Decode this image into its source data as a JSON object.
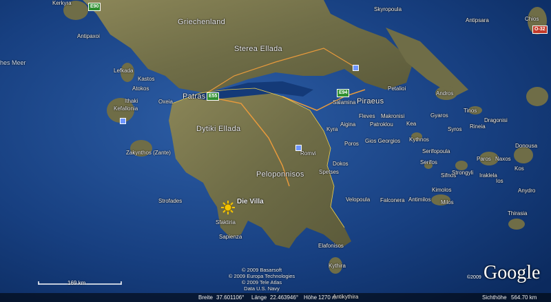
{
  "colors": {
    "sea_deep": "#0b2a5e",
    "sea_shallow": "#2d5ea6",
    "land": "#7d7a52",
    "land_dark": "#5b5a3a",
    "road_major": "#e89a3c",
    "border": "#f2d14b"
  },
  "labels": {
    "griechenland": "Griechenland",
    "kerkyra": "Kerkyra",
    "antipaxoi": "Antipaxoi",
    "sea": "hes Meer",
    "lefkada": "Lefkada",
    "kastos": "Kastos",
    "atokos": "Atokos",
    "ithaki": "Ithaki",
    "kefallonia": "Kefallonia",
    "oxeia": "Oxeia",
    "patras": "Patras",
    "sterea": "Sterea Ellada",
    "dytiki": "Dytiki Ellada",
    "zakynthos": "Zakynthos (Zante)",
    "peloponnisos": "Peloponnisos",
    "strofades": "Strofades",
    "villa": "Die Villa",
    "sfaktiria": "Sfaktiria",
    "sapienza": "Sapienza",
    "elafonisos": "Elafonisos",
    "kythira": "Kythira",
    "antikythira": "Antikythira",
    "velopoula": "Velopoula",
    "falconera": "Falconera",
    "antimilos": "Antimilos",
    "milos": "Milos",
    "kimolos": "Kimolos",
    "sifnos": "Sifnos",
    "serifos": "Serifos",
    "serifopoula": "Serifopoula",
    "kythnos": "Kythnos",
    "kea": "Kea",
    "makronisi": "Makronisi",
    "patroklou": "Patroklou",
    "fleves": "Fleves",
    "gios_georgios": "Gios Georgios",
    "aigina": "Aigina",
    "kyra": "Kyra",
    "poros": "Poros",
    "romvi": "Romvi",
    "dokos": "Dokos",
    "spetses": "Spetses",
    "salamina": "Salamina",
    "piraeus": "Piraeus",
    "petalioi": "Petalioi",
    "andros": "Andros",
    "tinos": "Tinos",
    "gyaros": "Gyaros",
    "syros": "Syros",
    "rineia": "Rineia",
    "dragonisi": "Dragonisi",
    "naxos": "Naxos",
    "paros": "Paros",
    "strongyli": "Strongyli",
    "iraklela": "Iraklela",
    "donousa": "Donousa",
    "kos": "Kos",
    "anydro": "Anydro",
    "ios": "Ios",
    "thirasia": "Thirasia",
    "skyropoula": "Skyropoula",
    "antipsara": "Antipsara",
    "chios": "Chios"
  },
  "roads": {
    "e90": "E90",
    "e55": "E55",
    "e94": "E94",
    "o32": "O-32"
  },
  "scale": {
    "label": "169 km"
  },
  "credits": [
    "© 2009 Basarsoft",
    "© 2009 Europa Technologies",
    "© 2009 Tele Atlas",
    "Data U.S. Navy"
  ],
  "logo": {
    "year": "©2009",
    "text": "Google"
  },
  "status": {
    "breite_label": "Breite",
    "breite": "37.601106°",
    "laenge_label": "Länge",
    "laenge": "22.463946°",
    "hoehe_label": "Höhe",
    "hoehe": "1270 m",
    "sicht_label": "Sichthöhe",
    "sicht": "564.70 km"
  }
}
